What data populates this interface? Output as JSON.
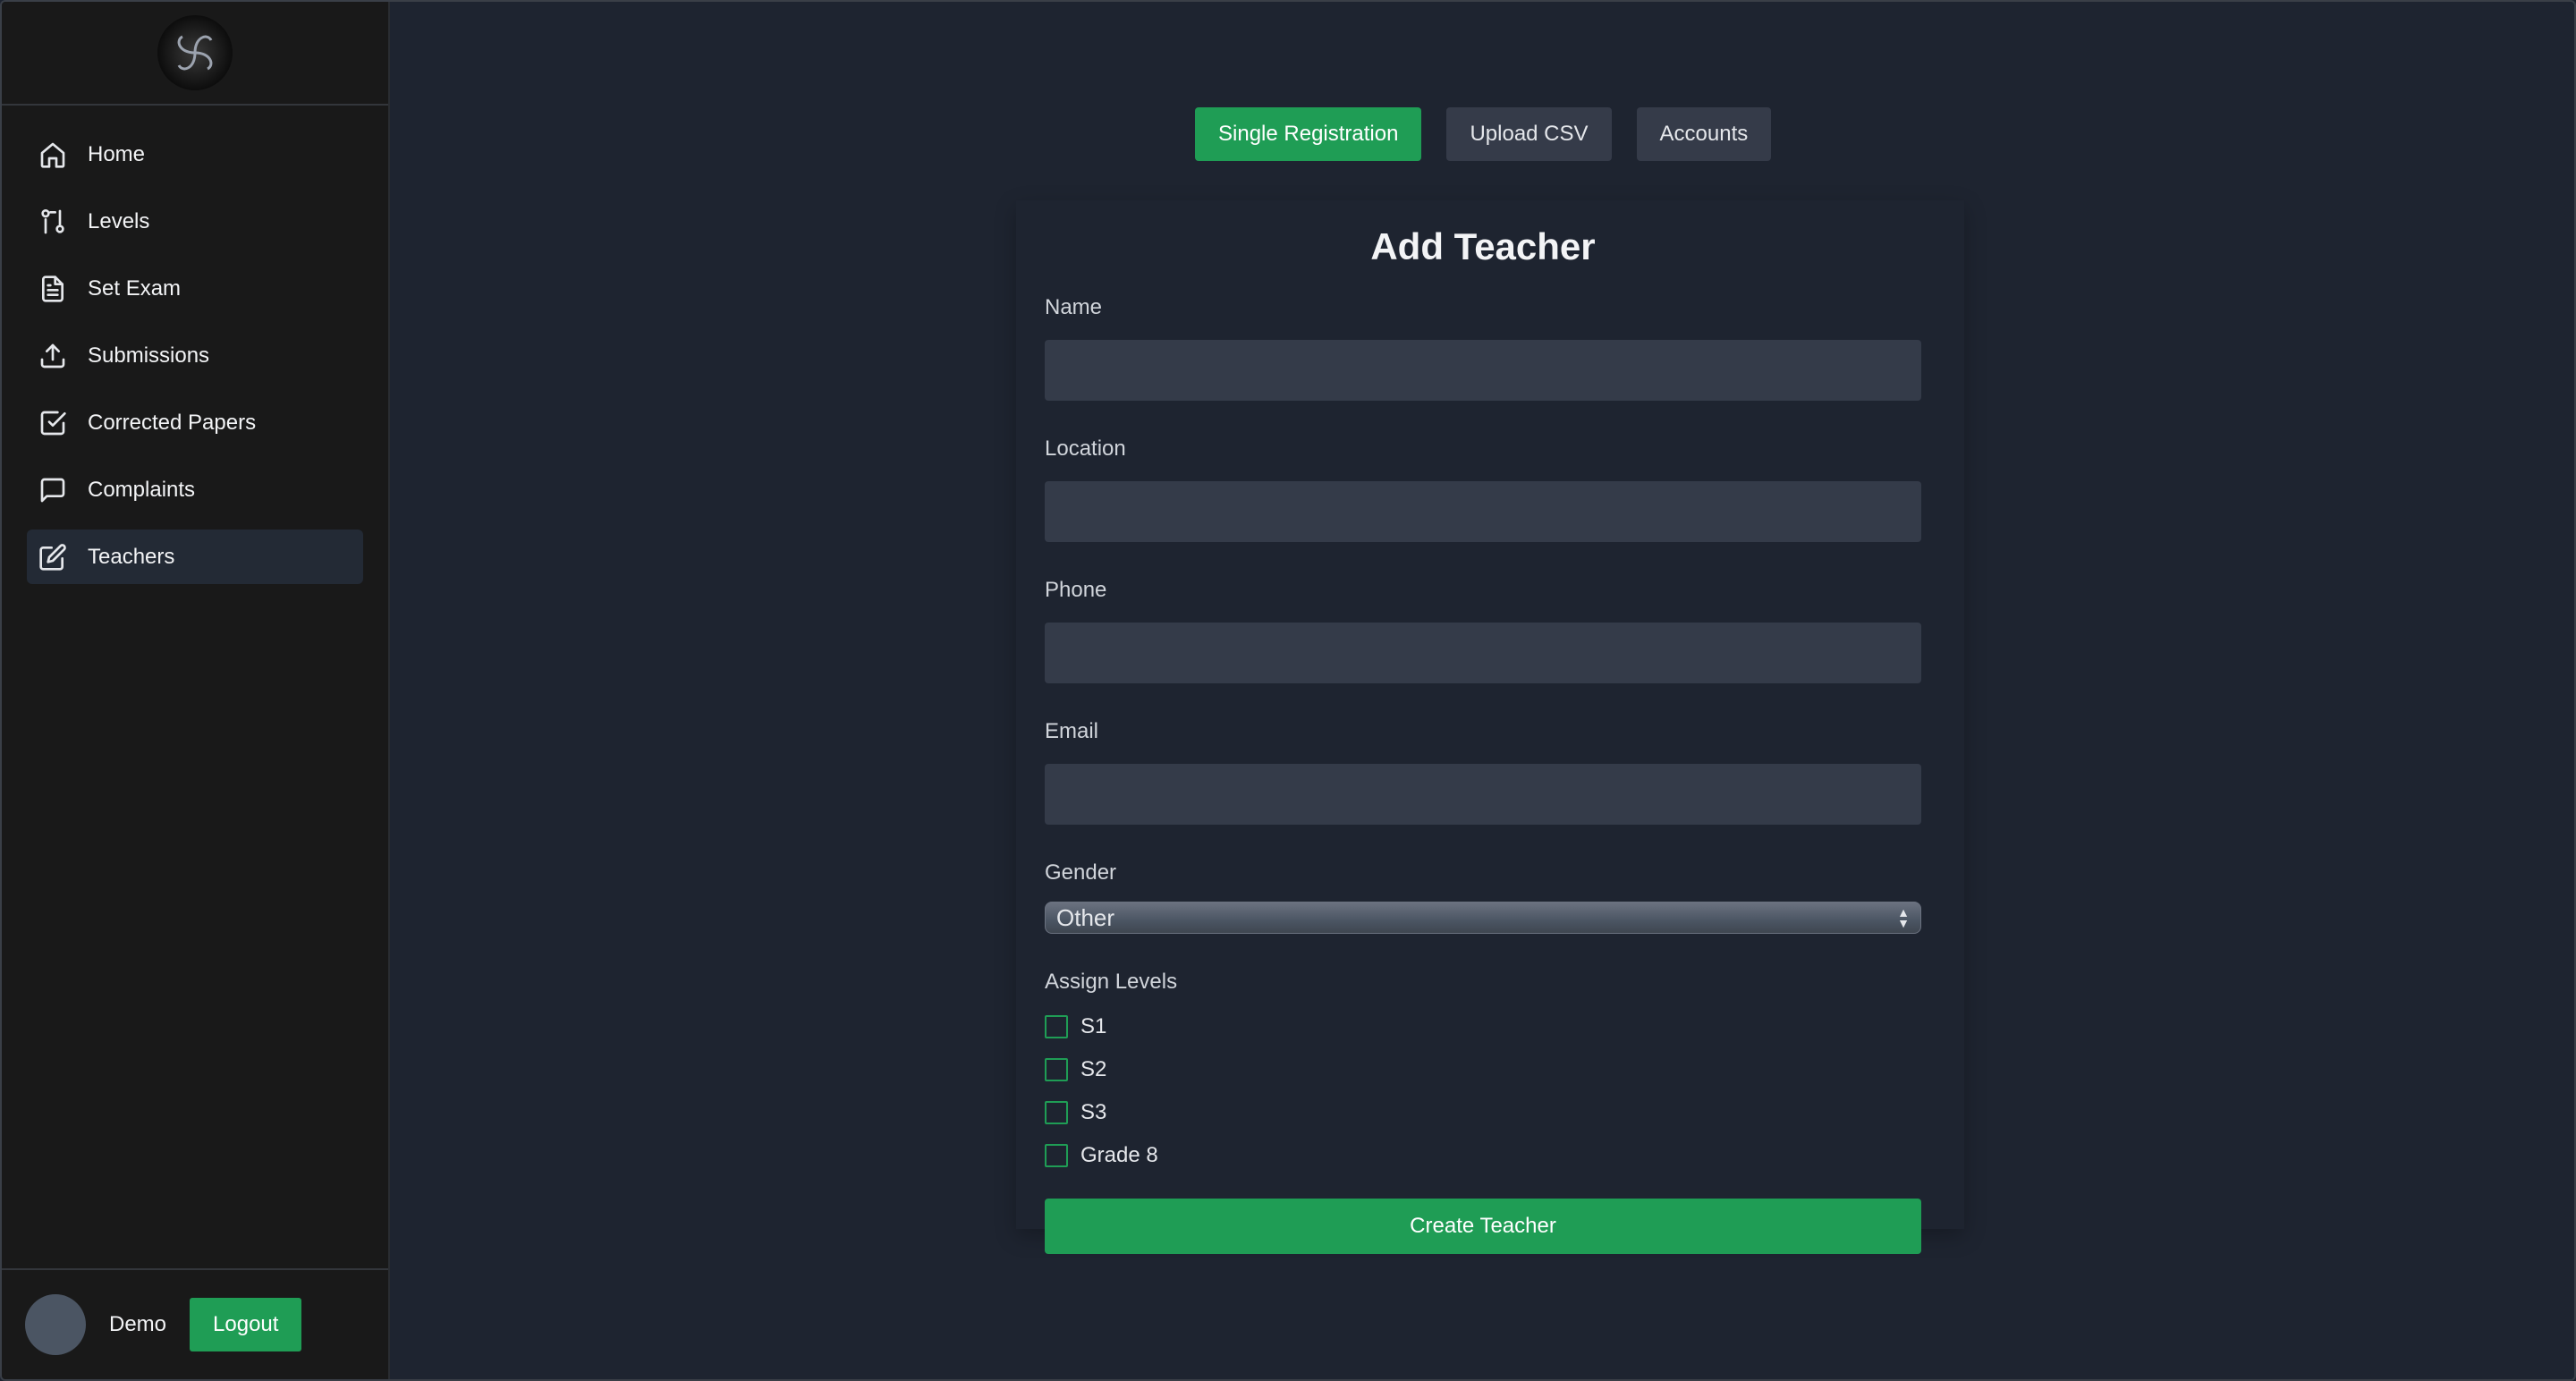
{
  "sidebar": {
    "items": [
      {
        "label": "Home",
        "icon": "home-icon"
      },
      {
        "label": "Levels",
        "icon": "levels-icon"
      },
      {
        "label": "Set Exam",
        "icon": "document-icon"
      },
      {
        "label": "Submissions",
        "icon": "upload-icon"
      },
      {
        "label": "Corrected Papers",
        "icon": "check-square-icon"
      },
      {
        "label": "Complaints",
        "icon": "message-icon"
      },
      {
        "label": "Teachers",
        "icon": "edit-icon",
        "active": true
      }
    ],
    "user": {
      "name": "Demo",
      "logout_label": "Logout"
    }
  },
  "tabs": [
    {
      "label": "Single Registration",
      "active": true
    },
    {
      "label": "Upload CSV",
      "active": false
    },
    {
      "label": "Accounts",
      "active": false
    }
  ],
  "form": {
    "title": "Add Teacher",
    "fields": {
      "name": {
        "label": "Name",
        "value": ""
      },
      "location": {
        "label": "Location",
        "value": ""
      },
      "phone": {
        "label": "Phone",
        "value": ""
      },
      "email": {
        "label": "Email",
        "value": ""
      }
    },
    "gender": {
      "label": "Gender",
      "selected": "Other"
    },
    "levels": {
      "label": "Assign Levels",
      "options": [
        {
          "label": "S1",
          "checked": false
        },
        {
          "label": "S2",
          "checked": false
        },
        {
          "label": "S3",
          "checked": false
        },
        {
          "label": "Grade 8",
          "checked": false
        }
      ]
    },
    "submit_label": "Create Teacher"
  },
  "colors": {
    "accent": "#1f9d55",
    "background": "#1e2430",
    "sidebar": "#191919",
    "input": "#343b49"
  }
}
